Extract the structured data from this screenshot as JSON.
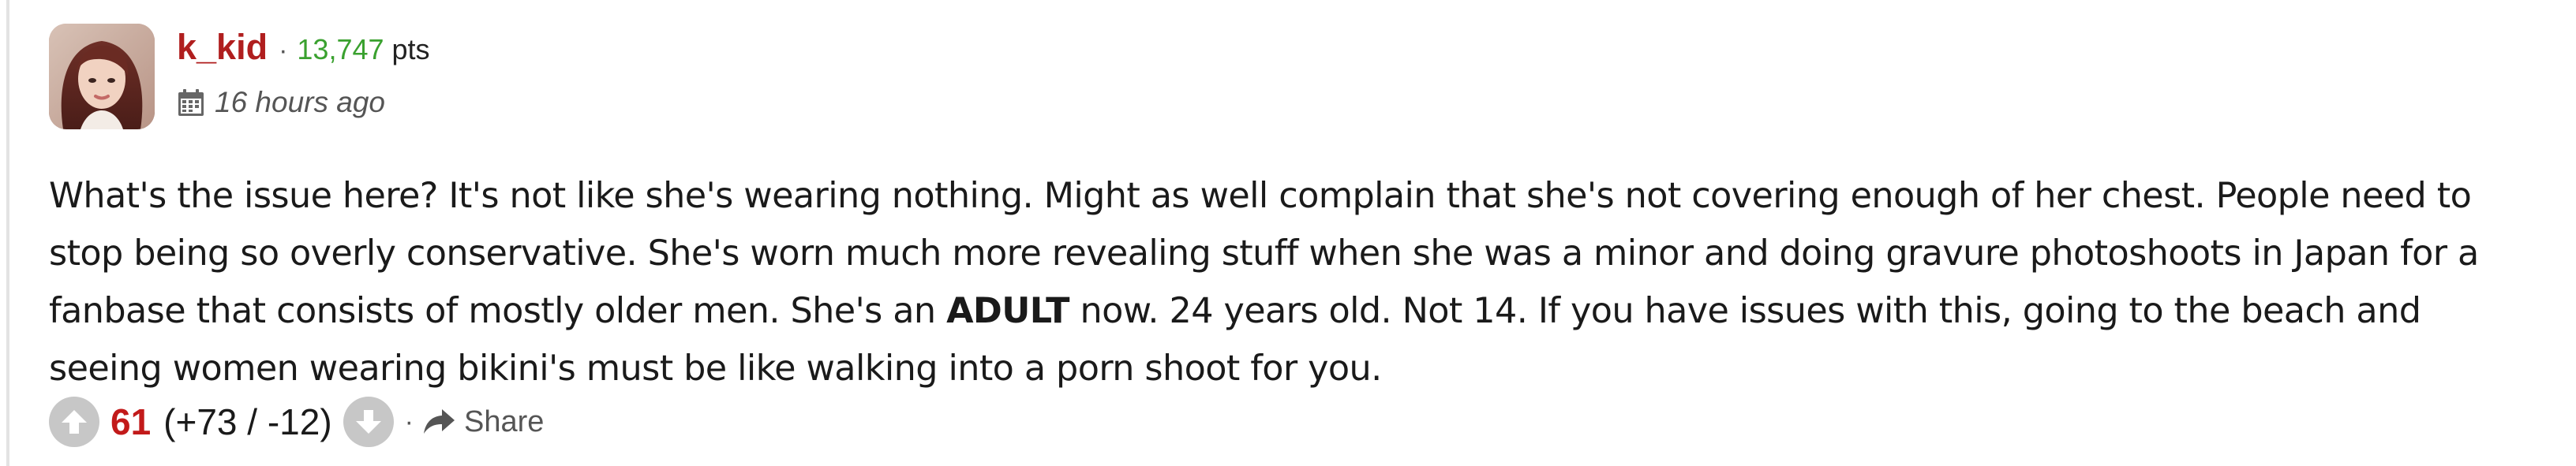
{
  "comment": {
    "author": "k_kid",
    "separator": "·",
    "points": "13,747",
    "points_label": "pts",
    "time_ago": "16 hours ago",
    "body_before_bold": "What's the issue here? It's not like she's wearing nothing. Might as well complain that she's not covering enough of her chest. People need to stop being so overly conservative. She's worn much more revealing stuff when she was a minor and doing gravure photoshoots in Japan for a fanbase that consists of mostly older men. She's an ",
    "body_bold": "ADULT",
    "body_after_bold": " now. 24 years old. Not 14. If you have issues with this, going to the beach and seeing women wearing bikini's must be like walking into a porn shoot for you."
  },
  "actions": {
    "score": "61",
    "breakdown": "(+73 / -12)",
    "separator": "·",
    "share_label": "Share"
  },
  "colors": {
    "username": "#b01e1e",
    "points": "#3aa12f",
    "score": "#c21a1a",
    "vote_button": "#c7c7c7",
    "muted": "#555555"
  },
  "icons": {
    "calendar": "calendar-icon",
    "upvote": "arrow-up-icon",
    "downvote": "arrow-down-icon",
    "share": "share-arrow-icon"
  }
}
